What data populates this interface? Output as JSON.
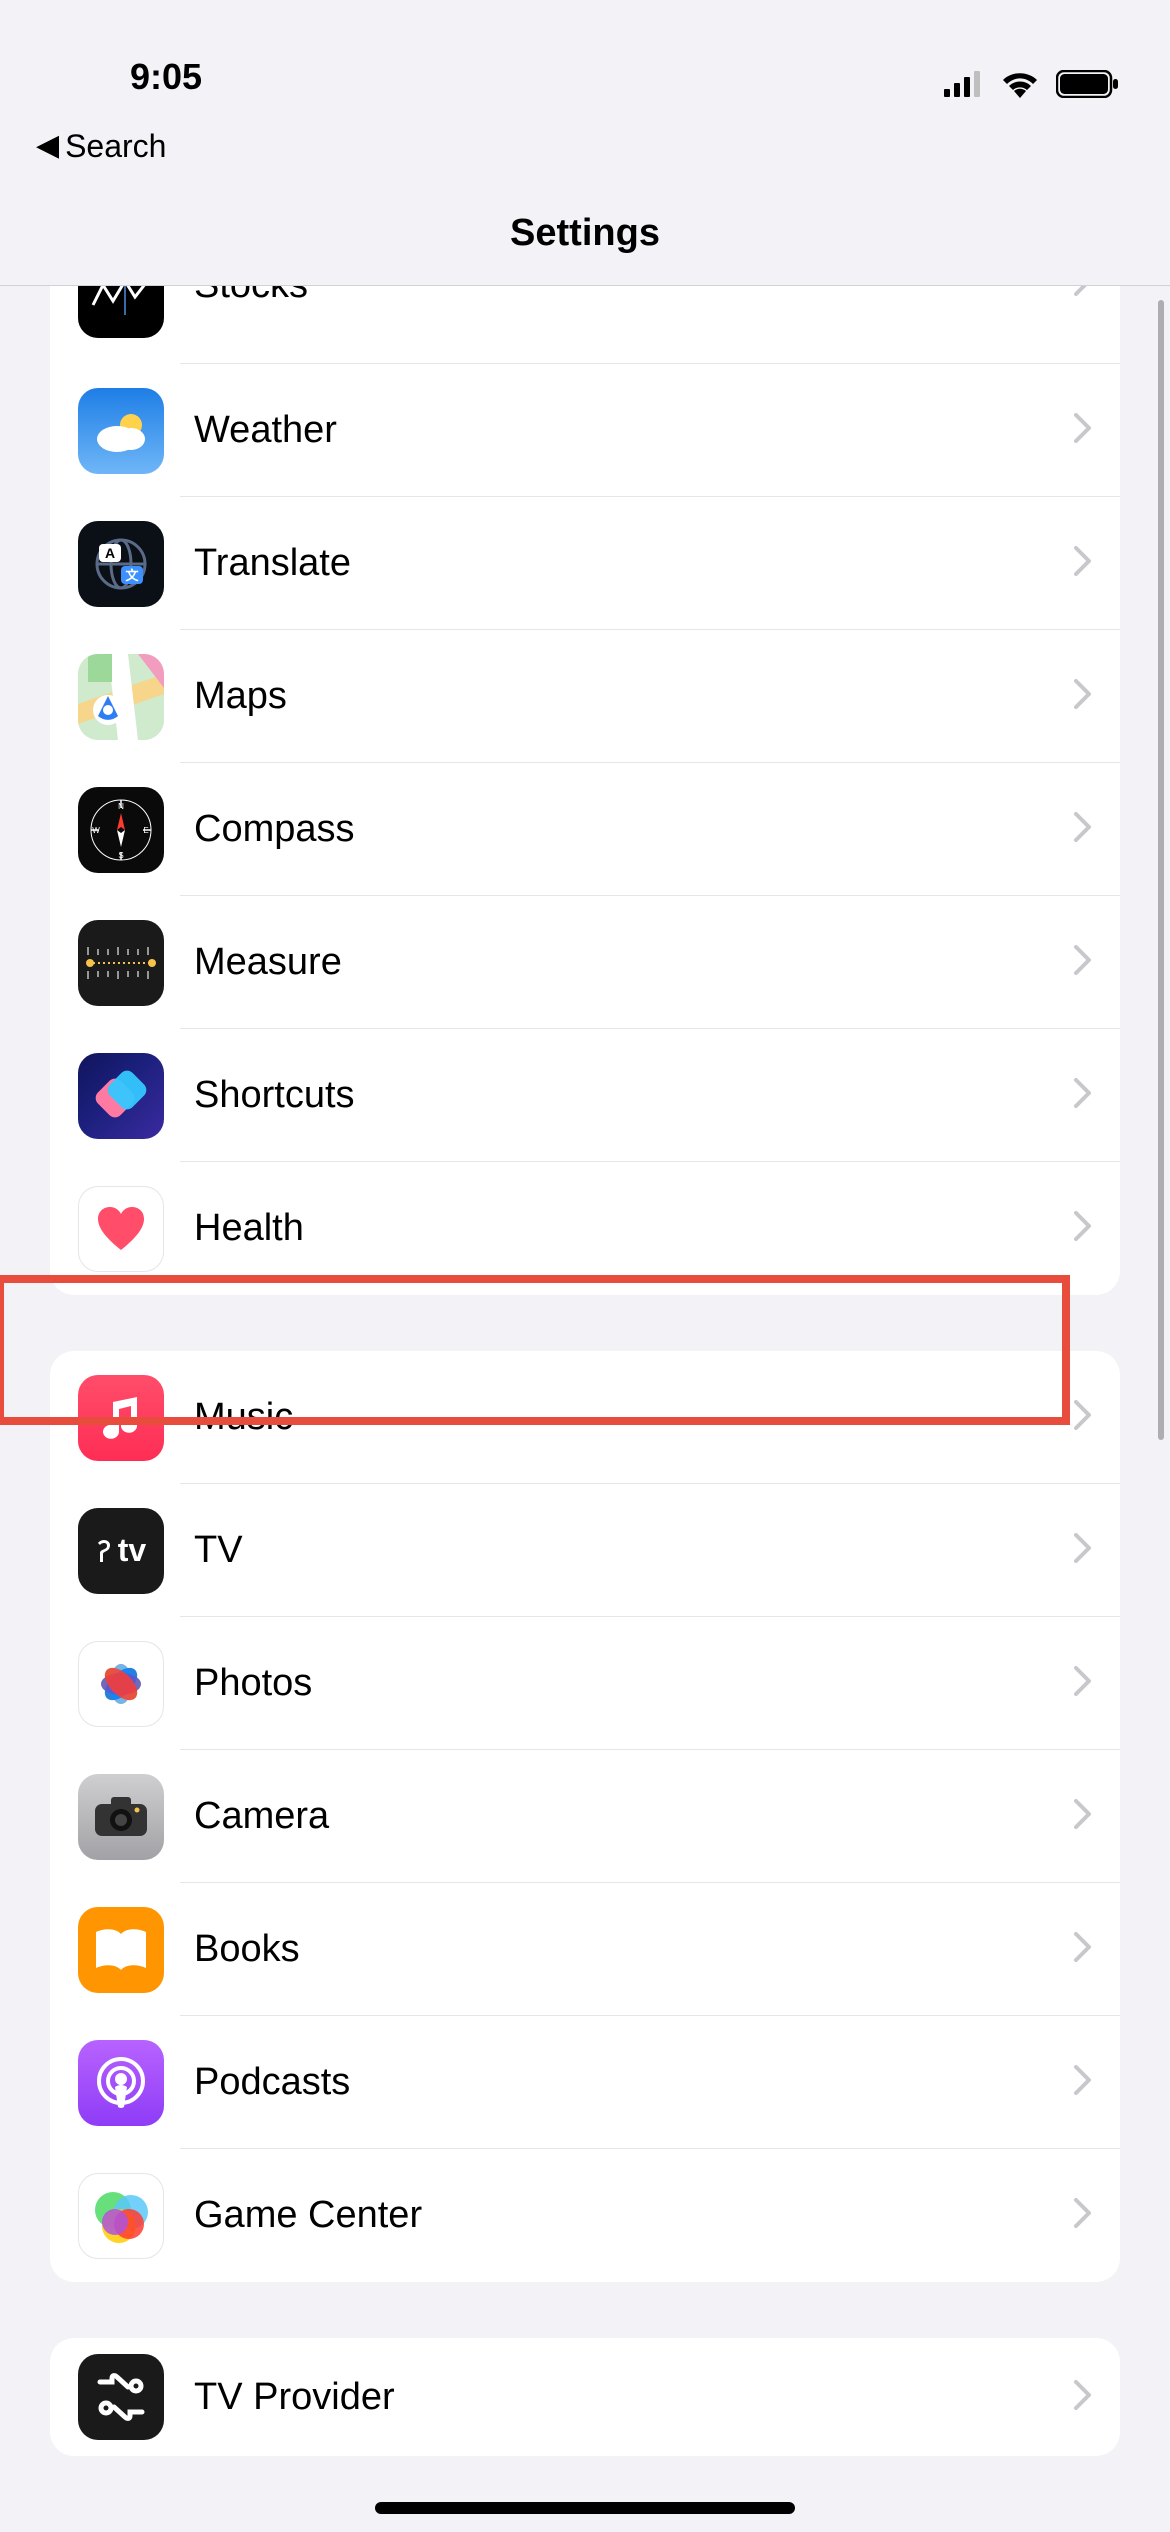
{
  "status": {
    "time": "9:05"
  },
  "back": {
    "label": "Search"
  },
  "title": "Settings",
  "groups": [
    {
      "id": "apps1",
      "items": [
        {
          "id": "stocks",
          "label": "Stocks"
        },
        {
          "id": "weather",
          "label": "Weather"
        },
        {
          "id": "translate",
          "label": "Translate"
        },
        {
          "id": "maps",
          "label": "Maps"
        },
        {
          "id": "compass",
          "label": "Compass"
        },
        {
          "id": "measure",
          "label": "Measure"
        },
        {
          "id": "shortcuts",
          "label": "Shortcuts"
        },
        {
          "id": "health",
          "label": "Health"
        }
      ]
    },
    {
      "id": "apps2",
      "items": [
        {
          "id": "music",
          "label": "Music"
        },
        {
          "id": "tv",
          "label": "TV"
        },
        {
          "id": "photos",
          "label": "Photos"
        },
        {
          "id": "camera",
          "label": "Camera"
        },
        {
          "id": "books",
          "label": "Books"
        },
        {
          "id": "podcasts",
          "label": "Podcasts"
        },
        {
          "id": "gamecenter",
          "label": "Game Center"
        }
      ]
    },
    {
      "id": "apps3",
      "items": [
        {
          "id": "tvprovider",
          "label": "TV Provider"
        }
      ]
    }
  ],
  "highlight": {
    "target_item_id": "health"
  }
}
